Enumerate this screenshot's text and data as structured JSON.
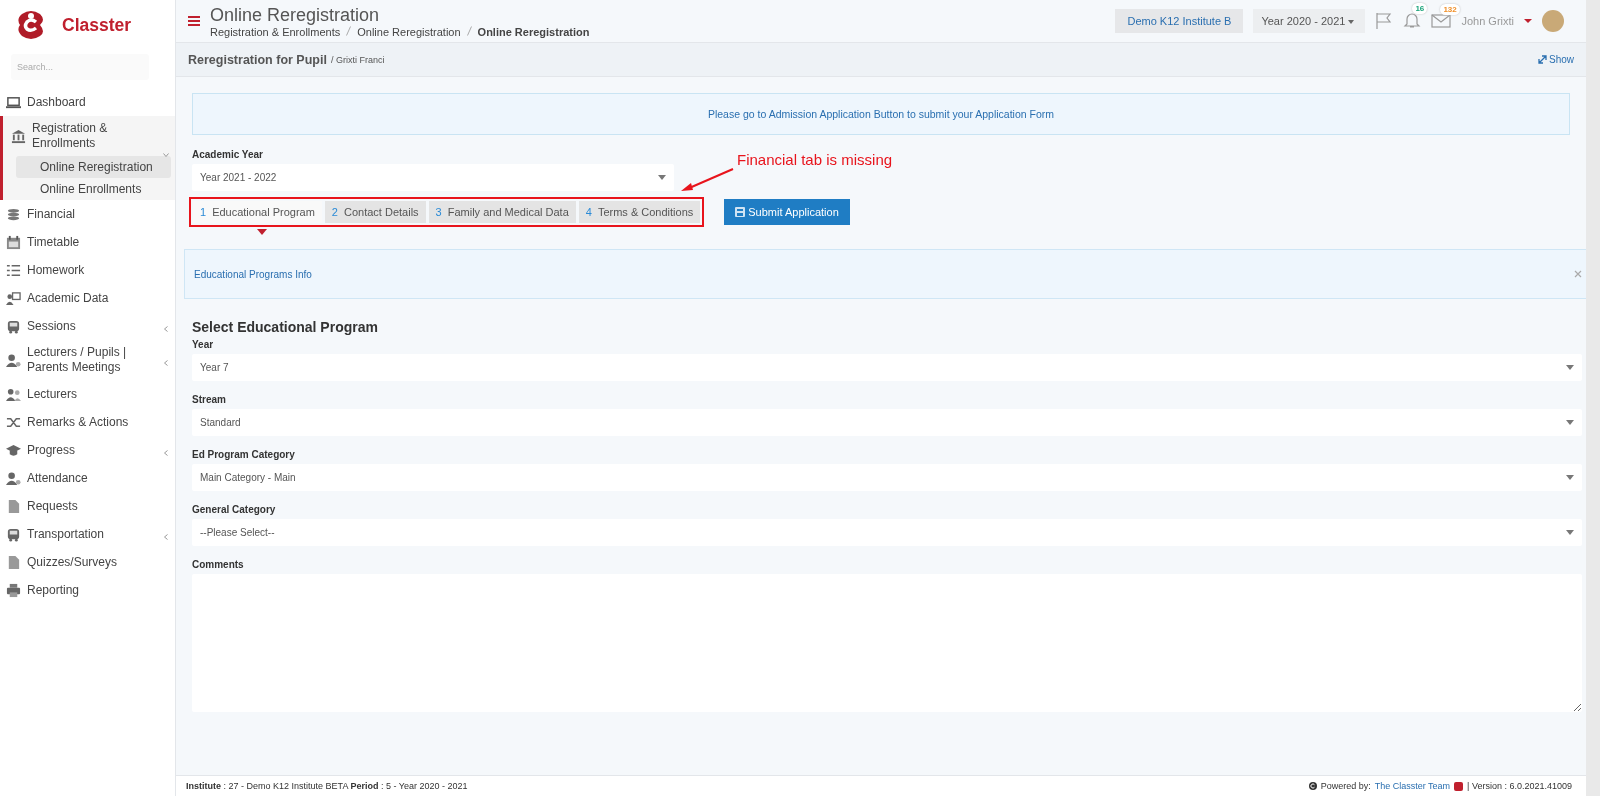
{
  "brand": {
    "name": "Classter"
  },
  "sidebar": {
    "search_placeholder": "Search...",
    "items": [
      {
        "label": "Dashboard",
        "selected": false
      },
      {
        "label": "Registration & Enrollments",
        "selected": true,
        "expanded": true,
        "children": [
          {
            "label": "Online Reregistration",
            "selected": true
          },
          {
            "label": "Online Enrollments",
            "selected": false
          }
        ]
      },
      {
        "label": "Financial",
        "selected": false
      },
      {
        "label": "Timetable",
        "selected": false
      },
      {
        "label": "Homework",
        "selected": false
      },
      {
        "label": "Academic Data",
        "selected": false
      },
      {
        "label": "Sessions",
        "selected": false,
        "expanded": false
      },
      {
        "label": "Lecturers / Pupils | Parents Meetings",
        "selected": false,
        "expanded": false
      },
      {
        "label": "Lecturers",
        "selected": false
      },
      {
        "label": "Remarks & Actions",
        "selected": false
      },
      {
        "label": "Progress",
        "selected": false,
        "expanded": false
      },
      {
        "label": "Attendance",
        "selected": false
      },
      {
        "label": "Requests",
        "selected": false
      },
      {
        "label": "Transportation",
        "selected": false,
        "expanded": false
      },
      {
        "label": "Quizzes/Surveys",
        "selected": false
      },
      {
        "label": "Reporting",
        "selected": false
      }
    ]
  },
  "header": {
    "title": "Online Reregistration",
    "breadcrumb": [
      "Registration & Enrollments",
      "Online Reregistration",
      "Online Reregistration"
    ],
    "institute_button": "Demo K12 Institute B",
    "year_select": "Year 2020 - 2021",
    "notifications": "16",
    "messages": "132",
    "user": "John Grixti"
  },
  "page": {
    "title": "Reregistration for Pupil",
    "subtitle": "/ Grixti Franci",
    "show_link": "Show",
    "notice": "Please go to Admission Application Button to submit your Application Form",
    "academic_year": {
      "label": "Academic Year",
      "value": "Year 2021 - 2022"
    },
    "tabs": [
      {
        "number": "1",
        "label": "Educational Program",
        "selected": true
      },
      {
        "number": "2",
        "label": "Contact Details",
        "selected": false
      },
      {
        "number": "3",
        "label": "Family and Medical Data",
        "selected": false
      },
      {
        "number": "4",
        "label": "Terms & Conditions",
        "selected": false
      }
    ],
    "submit_button": "Submit Application",
    "annotation": "Financial tab is missing",
    "info_panel": "Educational Programs Info",
    "section_title": "Select Educational Program",
    "fields": [
      {
        "label": "Year",
        "kind": "select",
        "value": "Year 7"
      },
      {
        "label": "Stream",
        "kind": "select",
        "value": "Standard"
      },
      {
        "label": "Ed Program Category",
        "kind": "select",
        "value": "Main Category - Main"
      },
      {
        "label": "General Category",
        "kind": "select",
        "value": "--Please Select--"
      },
      {
        "label": "Comments",
        "kind": "textarea"
      }
    ]
  },
  "footer": {
    "info": "**Institute** : 27 - Demo K12 Institute BETA **Period** : 5 - Year 2020 - 2021",
    "powered_by": "Powered by:",
    "team_link": "The Classter Team",
    "version": "| Version : 6.0.2021.41009"
  }
}
